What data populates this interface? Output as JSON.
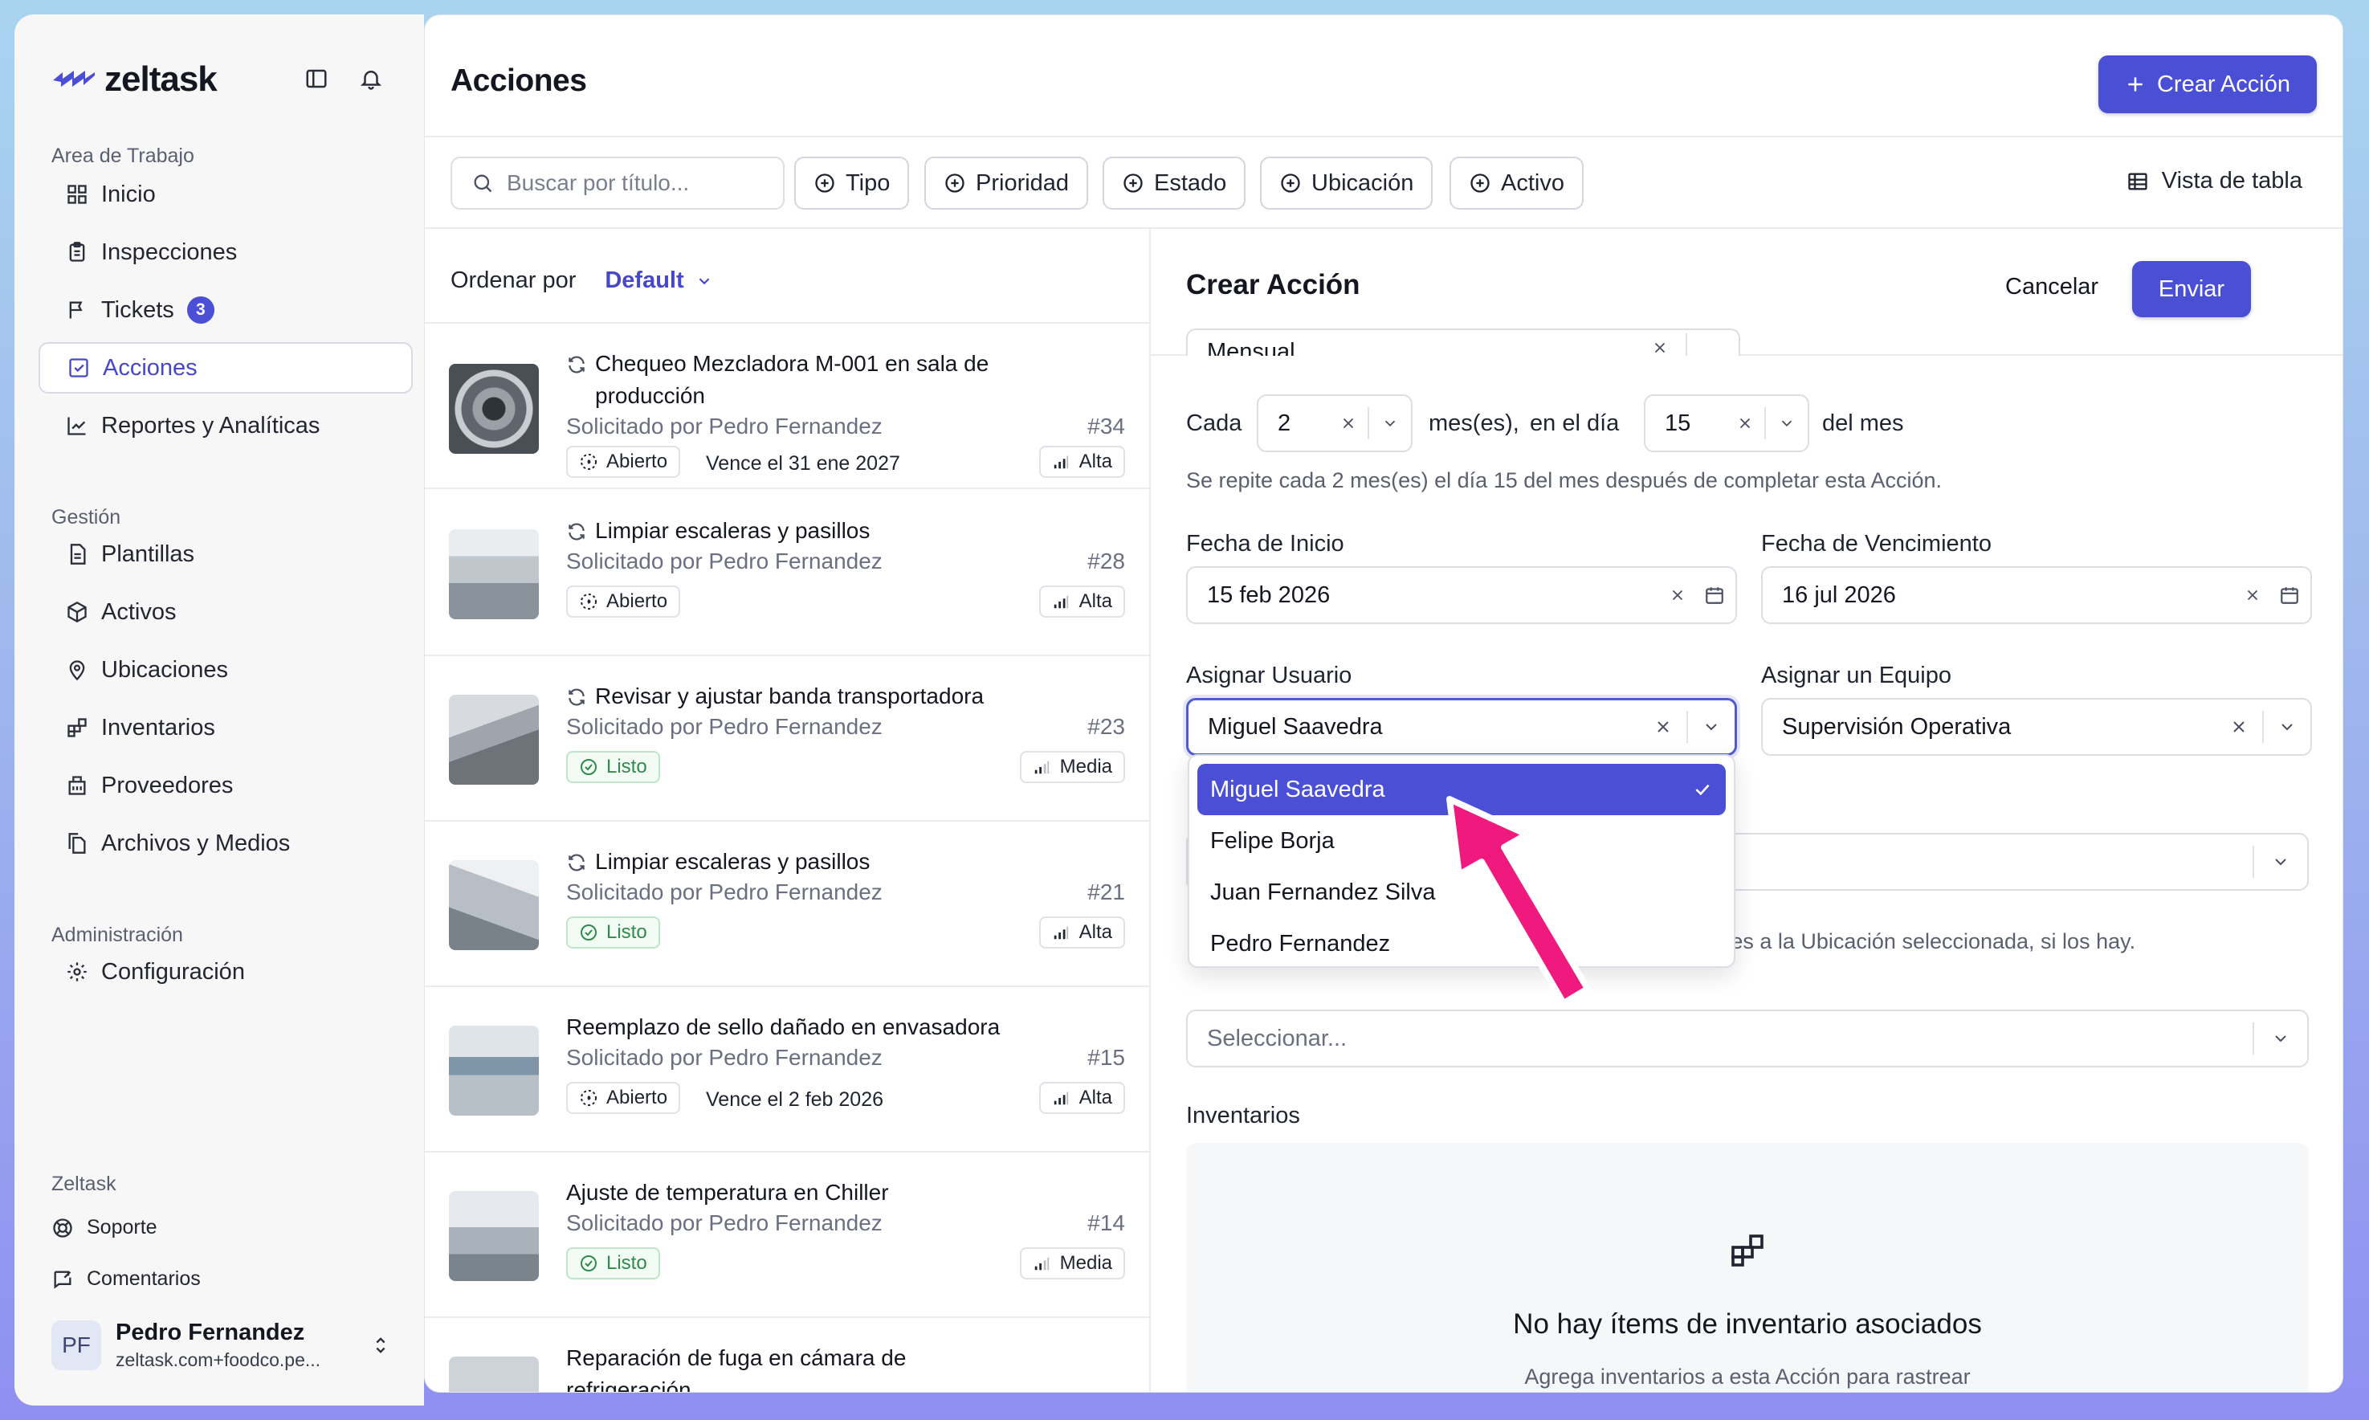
{
  "brand": {
    "name": "zeltask"
  },
  "sidebar": {
    "workspace_label": "Area de Trabajo",
    "workspace_items": [
      {
        "label": "Inicio",
        "icon": "grid-icon"
      },
      {
        "label": "Inspecciones",
        "icon": "clipboard-icon"
      },
      {
        "label": "Tickets",
        "icon": "flag-icon",
        "badge": "3"
      },
      {
        "label": "Acciones",
        "icon": "check-square-icon",
        "active": true
      },
      {
        "label": "Reportes y Analíticas",
        "icon": "chart-icon"
      }
    ],
    "management_label": "Gestión",
    "management_items": [
      {
        "label": "Plantillas",
        "icon": "file-icon"
      },
      {
        "label": "Activos",
        "icon": "box-icon"
      },
      {
        "label": "Ubicaciones",
        "icon": "pin-icon"
      },
      {
        "label": "Inventarios",
        "icon": "blocks-icon"
      },
      {
        "label": "Proveedores",
        "icon": "building-icon"
      },
      {
        "label": "Archivos y Medios",
        "icon": "files-icon"
      }
    ],
    "admin_label": "Administración",
    "admin_items": [
      {
        "label": "Configuración",
        "icon": "gear-icon"
      }
    ],
    "zeltask_label": "Zeltask",
    "zeltask_items": [
      {
        "label": "Soporte",
        "icon": "lifebuoy-icon"
      },
      {
        "label": "Comentarios",
        "icon": "comment-icon"
      }
    ],
    "user": {
      "initials": "PF",
      "name": "Pedro Fernandez",
      "email": "zeltask.com+foodco.pe..."
    }
  },
  "header": {
    "title": "Acciones",
    "create_label": "Crear Acción",
    "search_placeholder": "Buscar por título...",
    "filters": [
      "Tipo",
      "Prioridad",
      "Estado",
      "Ubicación",
      "Activo"
    ],
    "table_view_label": "Vista de tabla"
  },
  "list": {
    "sort_label": "Ordenar por",
    "sort_value": "Default",
    "items": [
      {
        "title": "Chequeo Mezcladora M-001 en sala de producción",
        "recurring": true,
        "requester": "Solicitado por Pedro Fernandez",
        "number": "#34",
        "status": "Abierto",
        "due": "Vence el 31 ene 2027",
        "priority": "Alta"
      },
      {
        "title": "Limpiar escaleras y pasillos",
        "recurring": true,
        "requester": "Solicitado por Pedro Fernandez",
        "number": "#28",
        "status": "Abierto",
        "due": "",
        "priority": "Alta"
      },
      {
        "title": "Revisar y ajustar banda transportadora",
        "recurring": true,
        "requester": "Solicitado por Pedro Fernandez",
        "number": "#23",
        "status": "Listo",
        "due": "",
        "priority": "Media"
      },
      {
        "title": "Limpiar escaleras y pasillos",
        "recurring": true,
        "requester": "Solicitado por Pedro Fernandez",
        "number": "#21",
        "status": "Listo",
        "due": "",
        "priority": "Alta"
      },
      {
        "title": "Reemplazo de sello dañado en envasadora",
        "recurring": false,
        "requester": "Solicitado por Pedro Fernandez",
        "number": "#15",
        "status": "Abierto",
        "due": "Vence el 2 feb 2026",
        "priority": "Alta"
      },
      {
        "title": "Ajuste de temperatura en Chiller",
        "recurring": false,
        "requester": "Solicitado por Pedro Fernandez",
        "number": "#14",
        "status": "Listo",
        "due": "",
        "priority": "Media"
      },
      {
        "title": "Reparación de fuga en cámara de refrigeración",
        "recurring": false,
        "requester": "",
        "number": "",
        "status": "",
        "due": "",
        "priority": ""
      }
    ]
  },
  "form": {
    "title": "Crear Acción",
    "cancel_label": "Cancelar",
    "submit_label": "Enviar",
    "frequency_value": "Mensual",
    "every_label": "Cada",
    "every_value": "2",
    "months_label": "mes(es),",
    "on_day_label": "en el día",
    "day_value": "15",
    "of_month_label": "del mes",
    "repeat_helper": "Se repite cada 2 mes(es) el día 15 del mes después de completar esta Acción.",
    "start_label": "Fecha de Inicio",
    "start_value": "15 feb 2026",
    "due_label": "Fecha de Vencimiento",
    "due_value": "16 jul 2026",
    "assign_user_label": "Asignar Usuario",
    "assign_user_value": "Miguel Saavedra",
    "assign_team_label": "Asignar un Equipo",
    "assign_team_value": "Supervisión Operativa",
    "asset_helper": "Esta lista muestra automáticamente Activos pertenecientes a la Ubicación seleccionada, si los hay.",
    "asset_placeholder": "Seleccionar...",
    "inventory_label": "Inventarios",
    "inventory_empty_title": "No hay ítems de inventario asociados",
    "inventory_empty_sub": "Agrega inventarios a esta Acción para rastrear",
    "user_options": [
      "Miguel Saavedra",
      "Felipe Borja",
      "Juan Fernandez Silva",
      "Pedro Fernandez"
    ],
    "selected_user_index": 0
  },
  "colors": {
    "accent": "#4a4fd6",
    "annotation_arrow": "#f0197d",
    "done_green": "#2f8a4b"
  }
}
